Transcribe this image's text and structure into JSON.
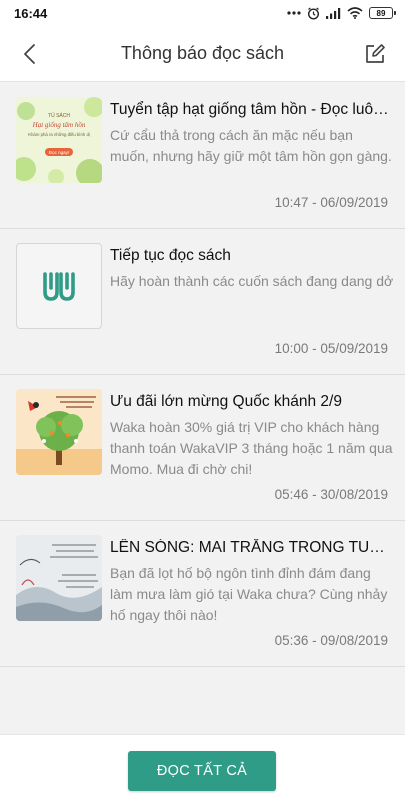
{
  "status_bar": {
    "time": "16:44",
    "battery": "89",
    "icons": [
      "more-dots-icon",
      "alarm-icon",
      "signal-icon",
      "wifi-icon",
      "battery-icon"
    ]
  },
  "header": {
    "title": "Thông báo đọc sách",
    "back_icon": "back-arrow-icon",
    "action_icon": "edit-icon"
  },
  "notifications": [
    {
      "title": "Tuyển tập hạt giống tâm hồn - Đọc luôn ...",
      "body": "Cứ cẩu thả trong cách ăn mặc nếu bạn muốn, nhưng hãy giữ một tâm hồn gọn gàng.",
      "time": "10:47 - 06/09/2019",
      "thumb_lines": [
        "TỦ SÁCH",
        "Hạt giống tâm hồn",
        "Khám phá ra những điều bình dị",
        "Đọc ngay!"
      ]
    },
    {
      "title": "Tiếp tục đọc sách",
      "body": "Hãy hoàn thành các cuốn sách đang dang dở",
      "time": "10:00 - 05/09/2019",
      "thumb_lines": []
    },
    {
      "title": "Ưu đãi lớn mừng Quốc khánh 2/9",
      "body": "Waka hoàn 30% giá trị VIP cho khách hàng thanh toán WakaVIP 3 tháng hoặc 1 năm qua Momo. Mua đi chờ chi!",
      "time": "05:46 - 30/08/2019",
      "thumb_lines": []
    },
    {
      "title": "LÊN SÓNG: MAI TRẮNG TRONG TUYẾT -...",
      "body": "Bạn đã lọt hố bộ ngôn tình đỉnh đám đang làm mưa làm gió tại Waka chưa? Cùng nhảy hố ngay thôi nào!",
      "time": "05:36 - 09/08/2019",
      "thumb_lines": []
    }
  ],
  "footer": {
    "read_all_label": "ĐỌC TẤT CẢ"
  },
  "colors": {
    "accent": "#2e9c86",
    "background": "#f2f2f2"
  }
}
